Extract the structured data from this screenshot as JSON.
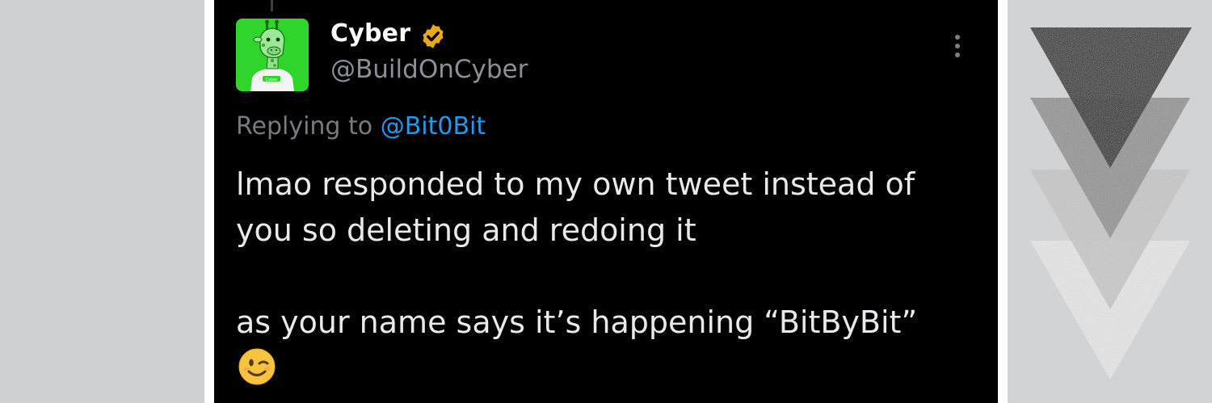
{
  "tweet": {
    "display_name": "Cyber",
    "handle": "@BuildOnCyber",
    "replying_prefix": "Replying to",
    "replying_to": "@Bit0Bit",
    "body_lines": [
      "lmao responded to my own tweet instead of",
      "you so deleting and redoing it",
      "as your name says  it’s happening “BitByBit”"
    ],
    "emoji": "😉",
    "avatar_shirt_text": "Cyber"
  },
  "colors": {
    "background": "#000000",
    "accent": "#1d9bf0",
    "verified_badge": "#e8a91c",
    "avatar_bg": "#2fd52a",
    "page_bg": "#cfd0d2"
  },
  "icons": {
    "verified": "verified-badge-icon",
    "more": "more-options-icon"
  }
}
